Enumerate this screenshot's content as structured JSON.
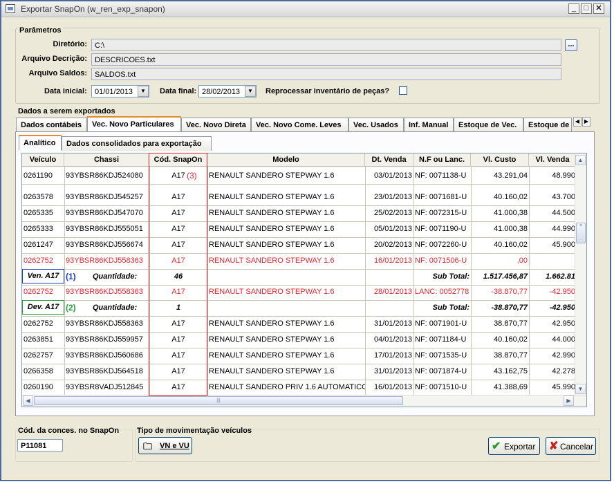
{
  "window": {
    "title": "Exportar SnapOn (w_ren_exp_snapon)"
  },
  "params": {
    "group_label": "Parâmetros",
    "diretorio_label": "Diretório:",
    "diretorio_value": "C:\\",
    "browse_label": "...",
    "arquivo_descricao_label": "Arquivo Decrição:",
    "arquivo_descricao_value": "DESCRICOES.txt",
    "arquivo_saldos_label": "Arquivo Saldos:",
    "arquivo_saldos_value": "SALDOS.txt",
    "data_inicial_label": "Data inicial:",
    "data_inicial_value": "01/01/2013",
    "data_final_label": "Data final:",
    "data_final_value": "28/02/2013",
    "reprocessar_label": "Reprocessar inventário de peças?"
  },
  "export": {
    "section_label": "Dados a serem exportados",
    "tabs": [
      "Dados contábeis",
      "Vec. Novo Particulares",
      "Vec. Novo Direta",
      "Vec. Novo Come. Leves",
      "Vec. Usados",
      "Inf. Manual",
      "Estoque de Vec.",
      "Estoque de Pe"
    ],
    "active_tab": "Vec. Novo Particulares",
    "subtabs": [
      "Analítico",
      "Dados consolidados para exportação"
    ],
    "active_subtab": "Analítico"
  },
  "grid": {
    "columns": [
      "Veículo",
      "Chassi",
      "Cód. SnapOn",
      "Modelo",
      "Dt. Venda",
      "N.F ou Lanc.",
      "Vl. Custo",
      "Vl. Venda"
    ],
    "rows": [
      {
        "veiculo": "0261190",
        "chassi": "93YBSR86KDJ524080",
        "cod": "A17",
        "marker": "(3)",
        "modelo": "RENAULT SANDERO STEPWAY 1.6",
        "dt": "03/01/2013",
        "nf": "NF: 0071138-U",
        "custo": "43.291,04",
        "venda": "48.990"
      },
      {
        "veiculo": "0263578",
        "chassi": "93YBSR86KDJ545257",
        "cod": "A17",
        "modelo": "RENAULT SANDERO STEPWAY 1.6",
        "dt": "23/01/2013",
        "nf": "NF: 0071681-U",
        "custo": "40.160,02",
        "venda": "43.700"
      },
      {
        "veiculo": "0265335",
        "chassi": "93YBSR86KDJ547070",
        "cod": "A17",
        "modelo": "RENAULT SANDERO STEPWAY 1.6",
        "dt": "25/02/2013",
        "nf": "NF: 0072315-U",
        "custo": "41.000,38",
        "venda": "44.500"
      },
      {
        "veiculo": "0265333",
        "chassi": "93YBSR86KDJ555051",
        "cod": "A17",
        "modelo": "RENAULT SANDERO STEPWAY 1.6",
        "dt": "05/01/2013",
        "nf": "NF: 0071190-U",
        "custo": "41.000,38",
        "venda": "44.990"
      },
      {
        "veiculo": "0261247",
        "chassi": "93YBSR86KDJ556674",
        "cod": "A17",
        "modelo": "RENAULT SANDERO STEPWAY 1.6",
        "dt": "20/02/2013",
        "nf": "NF: 0072260-U",
        "custo": "40.160,02",
        "venda": "45.900"
      },
      {
        "veiculo": "0262752",
        "chassi": "93YBSR86KDJ558363",
        "cod": "A17",
        "modelo": "RENAULT SANDERO STEPWAY 1.6",
        "dt": "16/01/2013",
        "nf": "NF: 0071506-U",
        "custo": ",00",
        "venda": "",
        "red": true
      },
      {
        "summary": true,
        "tag": "Ven. A17",
        "tagcolor": "#1f3fbf",
        "marker": "(1)",
        "qtd_label": "Quantidade:",
        "qtd": "46",
        "sub_label": "Sub Total:",
        "custo": "1.517.456,87",
        "venda": "1.662.81"
      },
      {
        "veiculo": "0262752",
        "chassi": "93YBSR86KDJ558363",
        "cod": "A17",
        "modelo": "RENAULT SANDERO STEPWAY 1.6",
        "dt": "28/01/2013",
        "nf": "LANC: 0052778",
        "custo": "-38.870,77",
        "venda": "-42.950",
        "red": true
      },
      {
        "summary": true,
        "tag": "Dev. A17",
        "tagcolor": "#2e9e3e",
        "marker": "(2)",
        "qtd_label": "Quantidade:",
        "qtd": "1",
        "sub_label": "Sub Total:",
        "custo": "-38.870,77",
        "venda": "-42.950"
      },
      {
        "veiculo": "0262752",
        "chassi": "93YBSR86KDJ558363",
        "cod": "A17",
        "modelo": "RENAULT SANDERO STEPWAY 1.6",
        "dt": "31/01/2013",
        "nf": "NF: 0071901-U",
        "custo": "38.870,77",
        "venda": "42.950"
      },
      {
        "veiculo": "0263851",
        "chassi": "93YBSR86KDJ559957",
        "cod": "A17",
        "modelo": "RENAULT SANDERO STEPWAY 1.6",
        "dt": "04/01/2013",
        "nf": "NF: 0071184-U",
        "custo": "40.160,02",
        "venda": "44.000"
      },
      {
        "veiculo": "0262757",
        "chassi": "93YBSR86KDJ560686",
        "cod": "A17",
        "modelo": "RENAULT SANDERO STEPWAY 1.6",
        "dt": "17/01/2013",
        "nf": "NF: 0071535-U",
        "custo": "38.870,77",
        "venda": "42.990"
      },
      {
        "veiculo": "0266358",
        "chassi": "93YBSR86KDJ564518",
        "cod": "A17",
        "modelo": "RENAULT SANDERO STEPWAY 1.6",
        "dt": "31/01/2013",
        "nf": "NF: 0071874-U",
        "custo": "43.162,75",
        "venda": "42.278"
      },
      {
        "veiculo": "0260190",
        "chassi": "93YBSR8VADJ512845",
        "cod": "A17",
        "modelo": "RENAULT SANDERO PRIV 1.6 AUTOMATICO",
        "dt": "16/01/2013",
        "nf": "NF: 0071510-U",
        "custo": "41.388,69",
        "venda": "45.990"
      }
    ]
  },
  "footer": {
    "cod_label": "Cód. da conces. no SnapOn",
    "cod_value": "P11081",
    "tipo_label": "Tipo de movimentação veículos",
    "vn_vu_label": "VN e VU",
    "exportar_label": "Exportar",
    "cancelar_label": "Cancelar"
  }
}
